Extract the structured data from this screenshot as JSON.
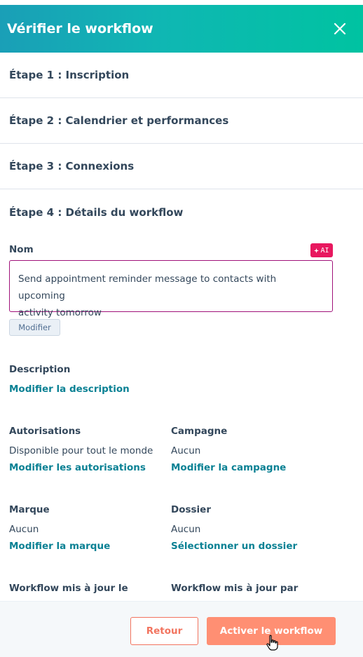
{
  "header": {
    "title": "Vérifier le workflow"
  },
  "steps": [
    {
      "label": "Étape 1 : Inscription"
    },
    {
      "label": "Étape 2 : Calendrier et performances"
    },
    {
      "label": "Étape 3 : Connexions"
    },
    {
      "label": "Étape 4 : Détails du workflow"
    }
  ],
  "name": {
    "label": "Nom",
    "ai_badge": "AI",
    "value_line1": "Send appointment reminder message to contacts with upcoming",
    "value_line2": "activity tomorrow",
    "edit_button": "Modifier"
  },
  "description": {
    "label": "Description",
    "link": "Modifier la description"
  },
  "permissions": {
    "label": "Autorisations",
    "value": "Disponible pour tout le monde",
    "link": "Modifier les autorisations"
  },
  "campaign": {
    "label": "Campagne",
    "value": "Aucun",
    "link": "Modifier la campagne"
  },
  "brand": {
    "label": "Marque",
    "value": "Aucun",
    "link": "Modifier la marque"
  },
  "folder": {
    "label": "Dossier",
    "value": "Aucun",
    "link": "Sélectionner un dossier"
  },
  "updated_on": {
    "label": "Workflow mis à jour le"
  },
  "updated_by": {
    "label": "Workflow mis à jour par"
  },
  "footer": {
    "back_button": "Retour",
    "activate_button": "Activer le workflow"
  },
  "colors": {
    "header_start": "#1a9fb7",
    "header_end": "#00c3a1",
    "link": "#0a8194",
    "primary": "#ff8f73",
    "ai_badge": "#e8185f"
  },
  "icons": {
    "close": "close-icon",
    "ai": "sparkle-icon",
    "cursor": "hand-pointer-icon"
  }
}
